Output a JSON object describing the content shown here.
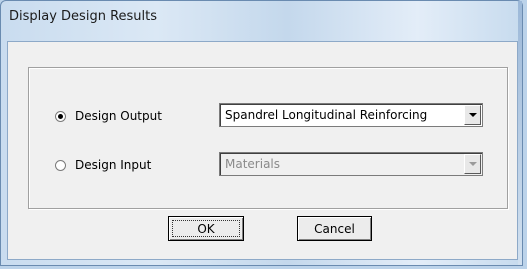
{
  "window": {
    "title": "Display Design Results"
  },
  "options": [
    {
      "label": "Design Output",
      "selected": true,
      "dropdown_value": "Spandrel Longitudinal Reinforcing",
      "enabled": true
    },
    {
      "label": "Design Input",
      "selected": false,
      "dropdown_value": "Materials",
      "enabled": false
    }
  ],
  "buttons": {
    "ok": "OK",
    "cancel": "Cancel"
  },
  "icons": {
    "radio": "radio-button-icon",
    "dropdown": "dropdown-arrow-icon"
  },
  "colors": {
    "client_bg": "#f0f0f0",
    "frame": "#c9dcef",
    "disabled_text": "#8a8a8a"
  }
}
